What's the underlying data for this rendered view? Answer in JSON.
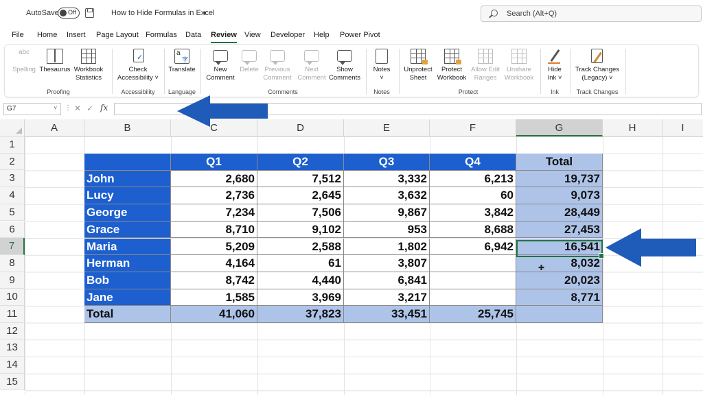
{
  "titlebar": {
    "autosave_label": "AutoSave",
    "autosave_state": "Off",
    "document_title": "How to Hide Formulas in Excel",
    "title_dropdown": "▾",
    "search_placeholder": "Search (Alt+Q)"
  },
  "tabs": [
    "File",
    "Home",
    "Insert",
    "Page Layout",
    "Formulas",
    "Data",
    "Review",
    "View",
    "Developer",
    "Help",
    "Power Pivot"
  ],
  "active_tab": "Review",
  "ribbon": {
    "groups": {
      "proofing": "Proofing",
      "accessibility": "Accessibility",
      "language": "Language",
      "comments": "Comments",
      "notes": "Notes",
      "protect": "Protect",
      "ink": "Ink",
      "track_changes": "Track Changes"
    },
    "buttons": {
      "spelling": "Spelling",
      "spelling_icon_text": "abc",
      "thesaurus": "Thesaurus",
      "workbook_statistics_1": "Workbook",
      "workbook_statistics_2": "Statistics",
      "check_accessibility_1": "Check",
      "check_accessibility_2": "Accessibility ˅",
      "translate": "Translate",
      "new_comment_1": "New",
      "new_comment_2": "Comment",
      "delete": "Delete",
      "previous_comment_1": "Previous",
      "previous_comment_2": "Comment",
      "next_comment_1": "Next",
      "next_comment_2": "Comment",
      "show_comments_1": "Show",
      "show_comments_2": "Comments",
      "notes": "Notes",
      "notes_arrow": "˅",
      "unprotect_sheet_1": "Unprotect",
      "unprotect_sheet_2": "Sheet",
      "protect_workbook_1": "Protect",
      "protect_workbook_2": "Workbook",
      "allow_edit_ranges_1": "Allow Edit",
      "allow_edit_ranges_2": "Ranges",
      "unshare_workbook_1": "Unshare",
      "unshare_workbook_2": "Workbook",
      "hide_ink_1": "Hide",
      "hide_ink_2": "Ink ˅",
      "track_changes_1": "Track Changes",
      "track_changes_2": "(Legacy) ˅"
    }
  },
  "formula_bar": {
    "name_box": "G7",
    "name_box_dropdown": "˅",
    "separator": "⋮",
    "cancel": "✕",
    "enter": "✓",
    "fx": "fx",
    "formula": ""
  },
  "sheet": {
    "columns": [
      "A",
      "B",
      "C",
      "D",
      "E",
      "F",
      "G",
      "H",
      "I"
    ],
    "selected_column": "G",
    "rows": [
      "1",
      "2",
      "3",
      "4",
      "5",
      "6",
      "7",
      "8",
      "9",
      "10",
      "11",
      "12",
      "13",
      "14",
      "15"
    ],
    "selected_row": "7",
    "selected_cell": "G7"
  },
  "table": {
    "headers": [
      "",
      "Q1",
      "Q2",
      "Q3",
      "Q4",
      "Total"
    ],
    "rows": [
      {
        "name": "John",
        "q1": "2,680",
        "q2": "7,512",
        "q3": "3,332",
        "q4": "6,213",
        "total": "19,737"
      },
      {
        "name": "Lucy",
        "q1": "2,736",
        "q2": "2,645",
        "q3": "3,632",
        "q4": "60",
        "total": "9,073"
      },
      {
        "name": "George",
        "q1": "7,234",
        "q2": "7,506",
        "q3": "9,867",
        "q4": "3,842",
        "total": "28,449"
      },
      {
        "name": "Grace",
        "q1": "8,710",
        "q2": "9,102",
        "q3": "953",
        "q4": "8,688",
        "total": "27,453"
      },
      {
        "name": "Maria",
        "q1": "5,209",
        "q2": "2,588",
        "q3": "1,802",
        "q4": "6,942",
        "total": "16,541"
      },
      {
        "name": "Herman",
        "q1": "4,164",
        "q2": "61",
        "q3": "3,807",
        "q4": "",
        "total": "8,032"
      },
      {
        "name": "Bob",
        "q1": "8,742",
        "q2": "4,440",
        "q3": "6,841",
        "q4": "",
        "total": "20,023"
      },
      {
        "name": "Jane",
        "q1": "1,585",
        "q2": "3,969",
        "q3": "3,217",
        "q4": "",
        "total": "8,771"
      }
    ],
    "totals": {
      "name": "Total",
      "q1": "41,060",
      "q2": "37,823",
      "q3": "33,451",
      "q4": "25,745",
      "total": ""
    }
  },
  "colors": {
    "header_blue": "#1d5fcf",
    "total_light_blue": "#aec3e8",
    "arrow_blue": "#1f5bb8",
    "excel_green": "#217346"
  },
  "icons": {
    "annotation_arrow": "arrow-left-icon",
    "cursor": "cross-cursor-icon"
  }
}
